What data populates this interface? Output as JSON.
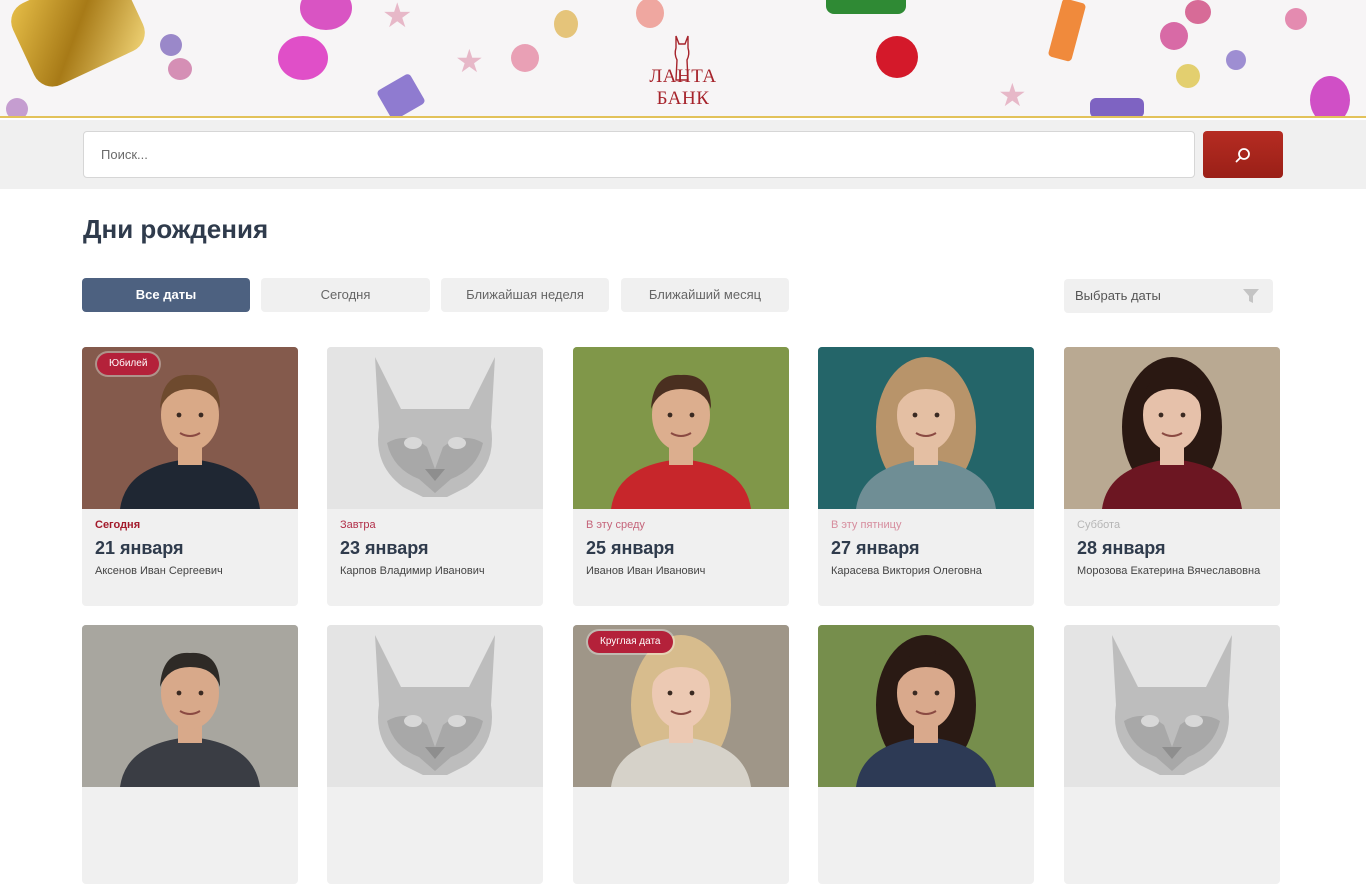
{
  "header": {
    "logo_text": "ЛАНТА БАНК"
  },
  "search": {
    "placeholder": "Поиск..."
  },
  "page": {
    "title": "Дни рождения"
  },
  "filters": {
    "items": [
      {
        "label": "Все даты",
        "active": true
      },
      {
        "label": "Сегодня",
        "active": false
      },
      {
        "label": "Ближайшая неделя",
        "active": false
      },
      {
        "label": "Ближайший месяц",
        "active": false
      }
    ],
    "date_picker_label": "Выбрать даты"
  },
  "cards": [
    {
      "badge": "Юбилей",
      "when": "Сегодня",
      "when_color": "#a31a2b",
      "date": "21 января",
      "name": "Аксенов Иван Сергеевич",
      "photo": "man-dark-shirt"
    },
    {
      "badge": "",
      "when": "Завтра",
      "when_color": "#b2304a",
      "date": "23 января",
      "name": "Карпов Владимир Иванович",
      "photo": "lynx-placeholder"
    },
    {
      "badge": "",
      "when": "В эту среду",
      "when_color": "#c5647a",
      "date": "25 января",
      "name": "Иванов Иван Иванович",
      "photo": "man-red-hoodie"
    },
    {
      "badge": "",
      "when": "В эту пятницу",
      "when_color": "#d68c9d",
      "date": "27 января",
      "name": "Карасева Виктория Олеговна",
      "photo": "woman-blonde-teal"
    },
    {
      "badge": "",
      "when": "Суббота",
      "when_color": "#b5b5b5",
      "date": "28  января",
      "name": "Морозова Екатерина Вячеславовна",
      "photo": "woman-dark-hair"
    },
    {
      "badge": "",
      "when": "",
      "when_color": "#b5b5b5",
      "date": "",
      "name": "",
      "photo": "man-smiling"
    },
    {
      "badge": "",
      "when": "",
      "when_color": "#b5b5b5",
      "date": "",
      "name": "",
      "photo": "lynx-placeholder"
    },
    {
      "badge": "Круглая дата",
      "when": "",
      "when_color": "#b5b5b5",
      "date": "",
      "name": "",
      "photo": "woman-blonde-street"
    },
    {
      "badge": "",
      "when": "",
      "when_color": "#b5b5b5",
      "date": "",
      "name": "",
      "photo": "woman-brunette-park"
    },
    {
      "badge": "",
      "when": "",
      "when_color": "#b5b5b5",
      "date": "",
      "name": "",
      "photo": "lynx-placeholder"
    }
  ],
  "colors": {
    "accent": "#a6232b",
    "primary_button": "#4d6180",
    "search_button": "#a8271d"
  }
}
